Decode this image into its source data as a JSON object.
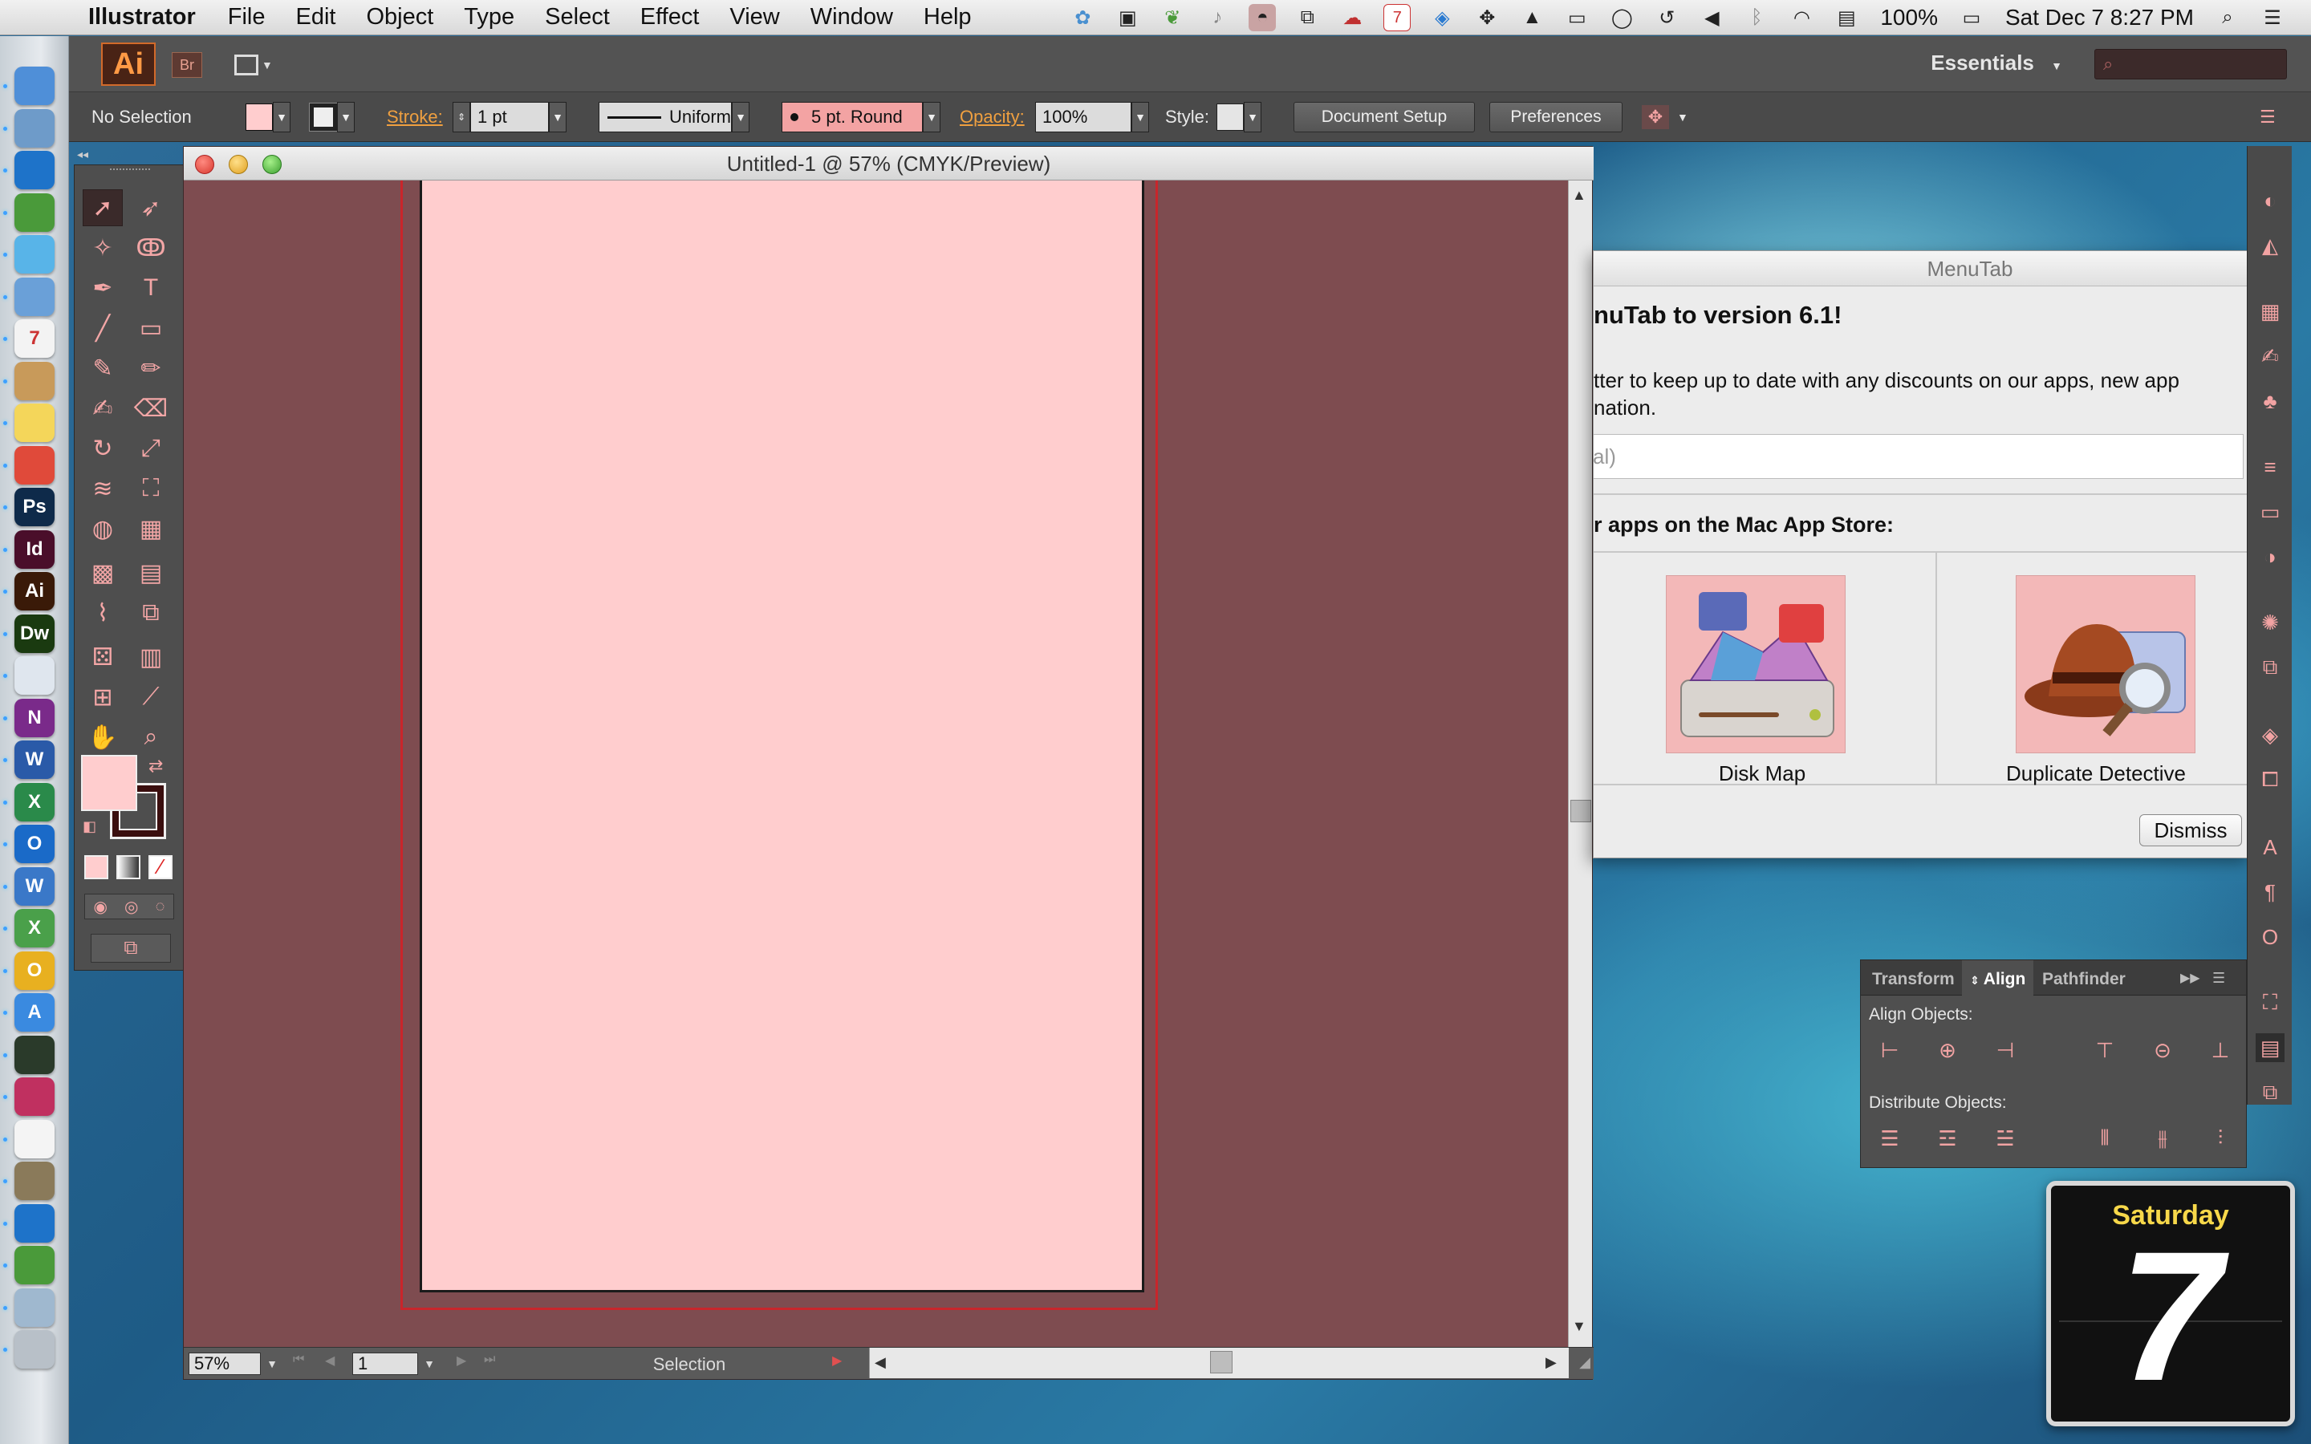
{
  "menubar": {
    "app_name": "Illustrator",
    "menus": [
      "File",
      "Edit",
      "Object",
      "Type",
      "Select",
      "Effect",
      "View",
      "Window",
      "Help"
    ],
    "battery": "100%",
    "datetime": "Sat Dec 7  8:27 PM",
    "calendar_badge": "7"
  },
  "dock": {
    "items": [
      {
        "name": "finder",
        "label": "",
        "color": "#4f8fd8"
      },
      {
        "name": "migration",
        "label": "",
        "color": "#6e9bc9"
      },
      {
        "name": "teamviewer",
        "label": "",
        "color": "#1e73c9"
      },
      {
        "name": "automator",
        "label": "",
        "color": "#4a9a3a"
      },
      {
        "name": "messages",
        "label": "",
        "color": "#58b4e8"
      },
      {
        "name": "mail",
        "label": "",
        "color": "#6aa0d8"
      },
      {
        "name": "calendar",
        "label": "7",
        "color": "#f3f3f3"
      },
      {
        "name": "contacts",
        "label": "",
        "color": "#c89a5a"
      },
      {
        "name": "stickies",
        "label": "",
        "color": "#f4d65a"
      },
      {
        "name": "chrome",
        "label": "",
        "color": "#e04a3a"
      },
      {
        "name": "photoshop",
        "label": "Ps",
        "color": "#0e2a4a"
      },
      {
        "name": "indesign",
        "label": "Id",
        "color": "#4a0e2a"
      },
      {
        "name": "illustrator",
        "label": "Ai",
        "color": "#3a1a08"
      },
      {
        "name": "dreamweaver",
        "label": "Dw",
        "color": "#1a3a10"
      },
      {
        "name": "safari",
        "label": "",
        "color": "#dfe6ee"
      },
      {
        "name": "onenote",
        "label": "N",
        "color": "#7a2a8a"
      },
      {
        "name": "word",
        "label": "W",
        "color": "#2a5aa8"
      },
      {
        "name": "excel",
        "label": "X",
        "color": "#2a8a4a"
      },
      {
        "name": "outlook",
        "label": "O",
        "color": "#1a6ac8"
      },
      {
        "name": "wunderlist",
        "label": "W",
        "color": "#3a78c8"
      },
      {
        "name": "xcode-like",
        "label": "X",
        "color": "#4aa04a"
      },
      {
        "name": "opera",
        "label": "O",
        "color": "#e8b020"
      },
      {
        "name": "appstore",
        "label": "A",
        "color": "#3a8ae0"
      },
      {
        "name": "activity-monitor",
        "label": "",
        "color": "#2a3a2a"
      },
      {
        "name": "photo-booth",
        "label": "",
        "color": "#c03060"
      },
      {
        "name": "launchpad",
        "label": "",
        "color": "#f4f4f4"
      },
      {
        "name": "disk-util",
        "label": "",
        "color": "#8a7a5a"
      },
      {
        "name": "teamviewer2",
        "label": "",
        "color": "#1e73c9"
      },
      {
        "name": "automator2",
        "label": "",
        "color": "#4a9a3a"
      },
      {
        "name": "downloads",
        "label": "",
        "color": "#9fb8cf"
      },
      {
        "name": "trash",
        "label": "",
        "color": "#b8c0c8"
      }
    ]
  },
  "appbar": {
    "logo": "Ai",
    "bridge": "Br",
    "workspace": "Essentials"
  },
  "controlbar": {
    "selection": "No Selection",
    "stroke_label": "Stroke:",
    "stroke_weight": "1 pt",
    "profile": "Uniform",
    "brush": "5 pt. Round",
    "opacity_label": "Opacity:",
    "opacity": "100%",
    "style_label": "Style:",
    "document_setup": "Document Setup",
    "preferences": "Preferences"
  },
  "document": {
    "title": "Untitled-1 @ 57% (CMYK/Preview)",
    "zoom": "57%",
    "artboard_number": "1",
    "status": "Selection"
  },
  "menutab": {
    "title": "MenuTab",
    "heading": "nuTab to version 6.1!",
    "body_line1": "tter to keep up to date with any discounts on our apps, new app",
    "body_line2": "nation.",
    "email_placeholder": "al)",
    "apps_heading": "r apps on the Mac App Store:",
    "apps": [
      "Disk Map",
      "Duplicate Detective"
    ],
    "dismiss": "Dismiss"
  },
  "align_panel": {
    "tabs": [
      "Transform",
      "Align",
      "Pathfinder"
    ],
    "align_objects": "Align Objects:",
    "distribute_objects": "Distribute Objects:"
  },
  "calendar_widget": {
    "day": "Saturday",
    "date": "7"
  },
  "colors": {
    "fill": "#ffcdce",
    "canvas": "#7e4c50",
    "accent": "#f0a040"
  }
}
